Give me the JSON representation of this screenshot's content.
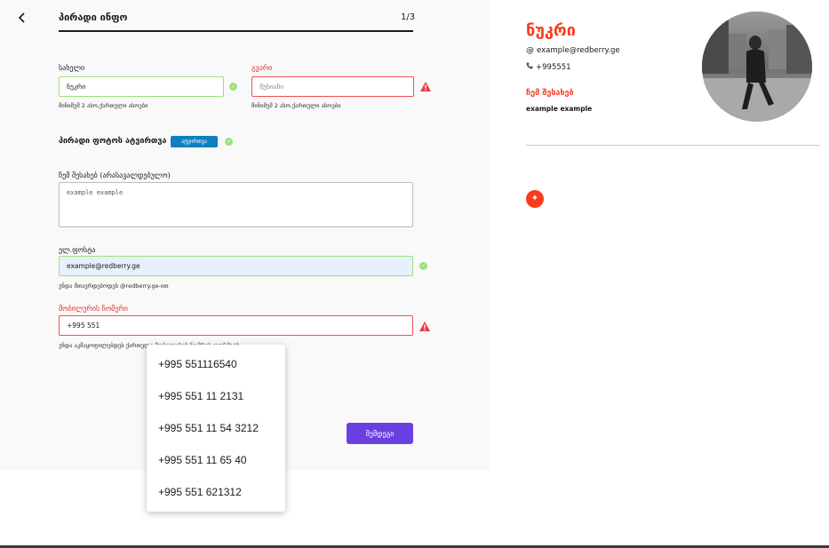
{
  "header": {
    "title": "პირადი ინფო",
    "step": "1/3"
  },
  "form": {
    "first_name": {
      "label": "სახელი",
      "value": "ნუკრი",
      "hint": "მინიმუმ 2 ასო,ქართული ასოები"
    },
    "last_name": {
      "label": "გვარი",
      "placeholder": "მუხიანი",
      "hint": "მინიმუმ 2 ასო,ქართული ასოები"
    },
    "photo": {
      "label": "პირადი ფოტოს ატვირთვა",
      "button": "ატვირთვა"
    },
    "about": {
      "label": "ჩემ შესახებ (არასავალდებულო)",
      "value": "example example"
    },
    "email": {
      "label": "ელ.ფოსტა",
      "value": "example@redberry.ge",
      "hint": "უნდა მთავრდებოდეს @redberry.ge-ით"
    },
    "phone": {
      "label": "მობილურის ნომერი",
      "value": "+995 551",
      "hint": "უნდა აკმაყოფილებდეს ქართული მობილურის ნომრის ფორმატს"
    },
    "next_button": "შემდეგი"
  },
  "autocomplete": {
    "options": [
      "+995 551116540",
      "+995 551 11 2131",
      "+995 551 11 54 3212",
      "+995 551 11 65 40",
      "+995 551 621312"
    ]
  },
  "resume": {
    "name": "ნუკრი",
    "email": "example@redberry.ge",
    "phone": "+995551",
    "about_title": "ჩემ შესახებ",
    "about": "example example",
    "email_icon": "at-icon",
    "phone_icon": "phone-icon"
  },
  "colors": {
    "accent_red": "#f93b1d",
    "valid_green": "#98e37e",
    "error_red": "#ef5050",
    "primary_purple": "#6b40e3",
    "upload_blue": "#0e80bf"
  }
}
